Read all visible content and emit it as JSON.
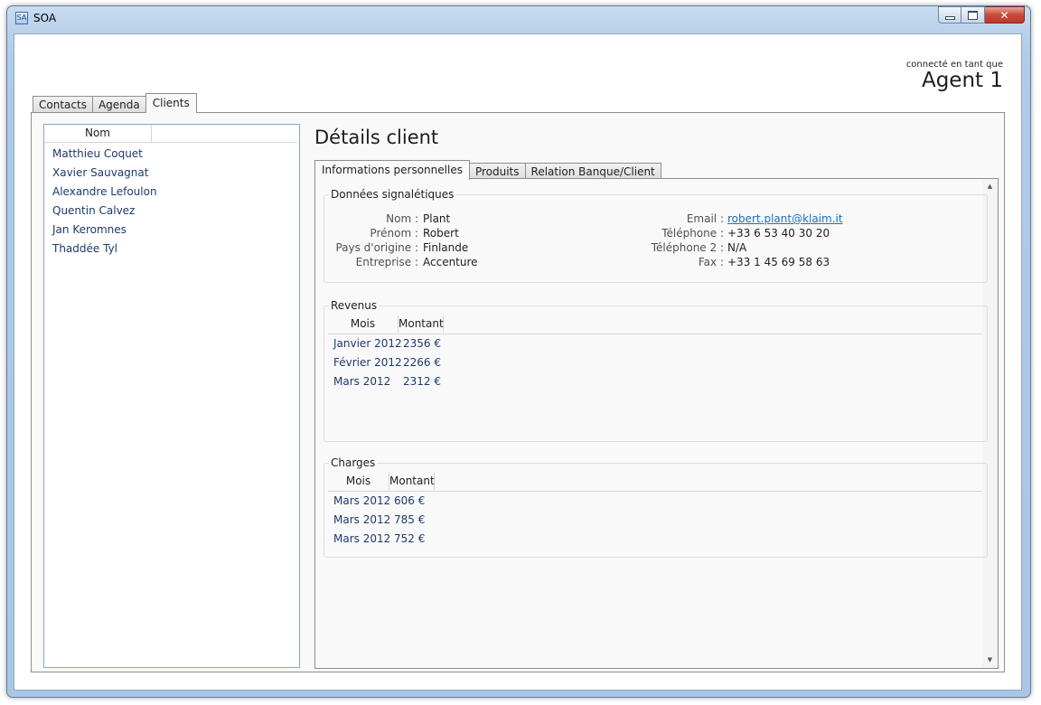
{
  "window": {
    "title": "SOA",
    "app_icon": "window-app-icon",
    "controls": {
      "minimize": "minimize-icon",
      "maximize": "maximize-icon",
      "close": "close-icon"
    }
  },
  "user": {
    "label": "connecté en tant que",
    "name": "Agent 1"
  },
  "main_tabs": [
    {
      "label": "Contacts",
      "active": false
    },
    {
      "label": "Agenda",
      "active": false
    },
    {
      "label": "Clients",
      "active": true
    }
  ],
  "client_list": {
    "header": "Nom",
    "items": [
      "Matthieu Coquet",
      "Xavier Sauvagnat",
      "Alexandre Lefoulon",
      "Quentin Calvez",
      "Jan Keromnes",
      "Thaddée Tyl"
    ]
  },
  "details": {
    "title": "Détails client",
    "tabs": [
      {
        "label": "Informations personnelles",
        "active": true
      },
      {
        "label": "Produits",
        "active": false
      },
      {
        "label": "Relation Banque/Client",
        "active": false
      }
    ],
    "identity": {
      "legend": "Données signalétiques",
      "left": [
        {
          "label": "Nom :",
          "value": "Plant"
        },
        {
          "label": "Prénom :",
          "value": "Robert"
        },
        {
          "label": "Pays d'origine :",
          "value": "Finlande"
        },
        {
          "label": "Entreprise :",
          "value": "Accenture"
        }
      ],
      "right": [
        {
          "label": "Email :",
          "value": "robert.plant@klaim.it"
        },
        {
          "label": "Téléphone :",
          "value": "+33 6 53 40 30 20"
        },
        {
          "label": "Téléphone 2 :",
          "value": "N/A"
        },
        {
          "label": "Fax :",
          "value": "+33 1 45 69 58 63"
        }
      ]
    },
    "revenus": {
      "legend": "Revenus",
      "columns": [
        "Mois",
        "Montant"
      ],
      "rows": [
        [
          "Janvier 2012",
          "2356 €"
        ],
        [
          "Février 2012",
          "2266 €"
        ],
        [
          "Mars 2012",
          "2312 €"
        ]
      ]
    },
    "charges": {
      "legend": "Charges",
      "columns": [
        "Mois",
        "Montant"
      ],
      "rows": [
        [
          "Mars 2012",
          "606 €"
        ],
        [
          "Mars 2012",
          "785 €"
        ],
        [
          "Mars 2012",
          "752 €"
        ]
      ]
    },
    "scrollbar": {
      "up": "▲",
      "down": "▼"
    }
  }
}
